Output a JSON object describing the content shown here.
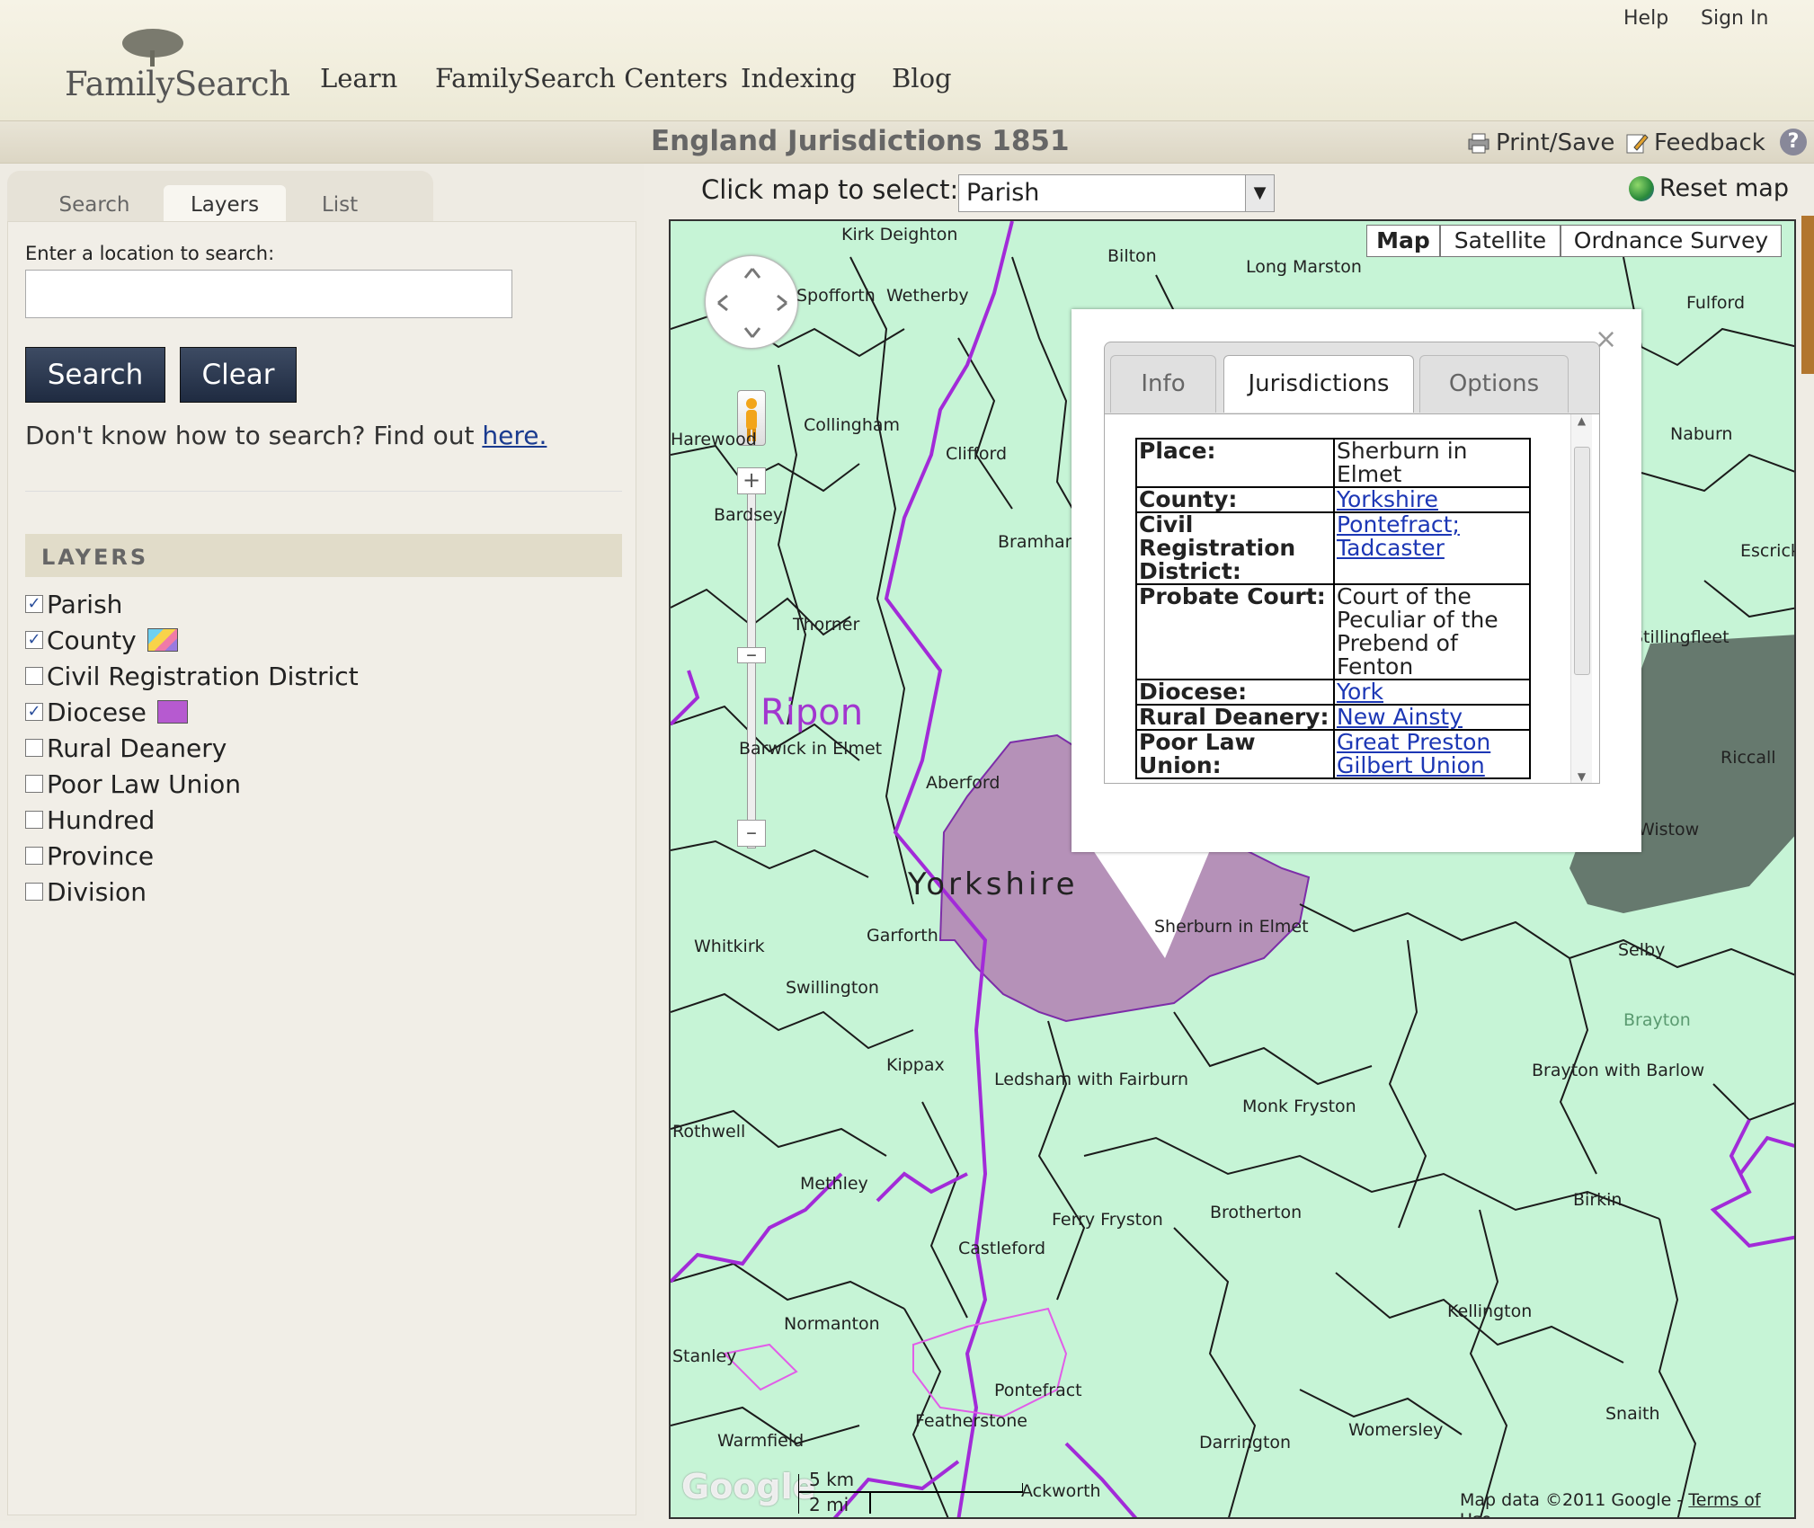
{
  "header": {
    "logo_text": "FamilySearch",
    "nav": [
      "Learn",
      "FamilySearch Centers",
      "Indexing",
      "Blog"
    ],
    "help_link": "Help",
    "signin_link": "Sign In"
  },
  "titlebar": {
    "title": "England Jurisdictions 1851",
    "print_label": "Print/Save",
    "feedback_label": "Feedback",
    "help_icon": "question-icon"
  },
  "left_panel": {
    "tabs": [
      "Search",
      "Layers",
      "List"
    ],
    "active_tab": "Layers",
    "search_label": "Enter a location to search:",
    "search_value": "",
    "search_button": "Search",
    "clear_button": "Clear",
    "help_text": "Don't know how to search? Find out ",
    "help_link": "here.",
    "layers_header": "LAYERS",
    "layers": [
      {
        "label": "Parish",
        "checked": true,
        "swatch": null
      },
      {
        "label": "County",
        "checked": true,
        "swatch": "multicolor"
      },
      {
        "label": "Civil Registration District",
        "checked": false,
        "swatch": null
      },
      {
        "label": "Diocese",
        "checked": true,
        "swatch": "#b65ad0"
      },
      {
        "label": "Rural Deanery",
        "checked": false,
        "swatch": null
      },
      {
        "label": "Poor Law Union",
        "checked": false,
        "swatch": null
      },
      {
        "label": "Hundred",
        "checked": false,
        "swatch": null
      },
      {
        "label": "Province",
        "checked": false,
        "swatch": null
      },
      {
        "label": "Division",
        "checked": false,
        "swatch": null
      }
    ]
  },
  "map_toolbar": {
    "click_label": "Click map to select:",
    "select_value": "Parish",
    "reset_label": "Reset map"
  },
  "map": {
    "map_types": [
      "Map",
      "Satellite",
      "Ordnance Survey"
    ],
    "active_type": "Map",
    "places": [
      "Kirk Deighton",
      "Bilton",
      "Long Marston",
      "Spofforth",
      "Wetherby",
      "Fulford",
      "Harewood",
      "Collingham",
      "Naburn",
      "Bardsey",
      "Clifford",
      "Bramham",
      "Escrick",
      "Thorner",
      "Ripon",
      "Barwick in Elmet",
      "Aberford",
      "Stillingfleet",
      "Riccall",
      "Whitkirk",
      "Garforth",
      "Yorkshire",
      "Sherburn in Elmet",
      "Wistow",
      "Selby",
      "Swillington",
      "Kippax",
      "Ledsham with Fairburn",
      "Brayton with Barlow",
      "Rothwell",
      "Monk Fryston",
      "Methley",
      "Ferry Fryston",
      "Brotherton",
      "Birkin",
      "Castleford",
      "Normanton",
      "Kellington",
      "Stanley",
      "Pontefract",
      "Featherstone",
      "Snaith",
      "Warmfield",
      "Darrington",
      "Womersley",
      "Ackworth",
      "Brayton"
    ],
    "scale_km": "5 km",
    "scale_mi": "2 mi",
    "copyright": "Map data ©2011 Google - ",
    "terms": "Terms of Use",
    "google_logo": "Google",
    "county_color": "#c6f4d6",
    "boundary_color": "#a22bd8",
    "selected_fill": "#b591b8"
  },
  "infowindow": {
    "tabs": [
      "Info",
      "Jurisdictions",
      "Options"
    ],
    "active_tab": "Jurisdictions",
    "close": "×",
    "rows": [
      {
        "key": "Place:",
        "value": "Sherburn in Elmet",
        "link": false
      },
      {
        "key": "County:",
        "value": "Yorkshire",
        "link": true
      },
      {
        "key": "Civil Registration District:",
        "value": "Pontefract; Tadcaster",
        "link": true
      },
      {
        "key": "Probate Court:",
        "value": "Court of the Peculiar of the Prebend of Fenton",
        "link": false
      },
      {
        "key": "Diocese:",
        "value": "York",
        "link": true
      },
      {
        "key": "Rural Deanery:",
        "value": "New Ainsty",
        "link": true
      },
      {
        "key": "Poor Law Union:",
        "value": "Great Preston Gilbert Union",
        "link": true
      }
    ]
  }
}
